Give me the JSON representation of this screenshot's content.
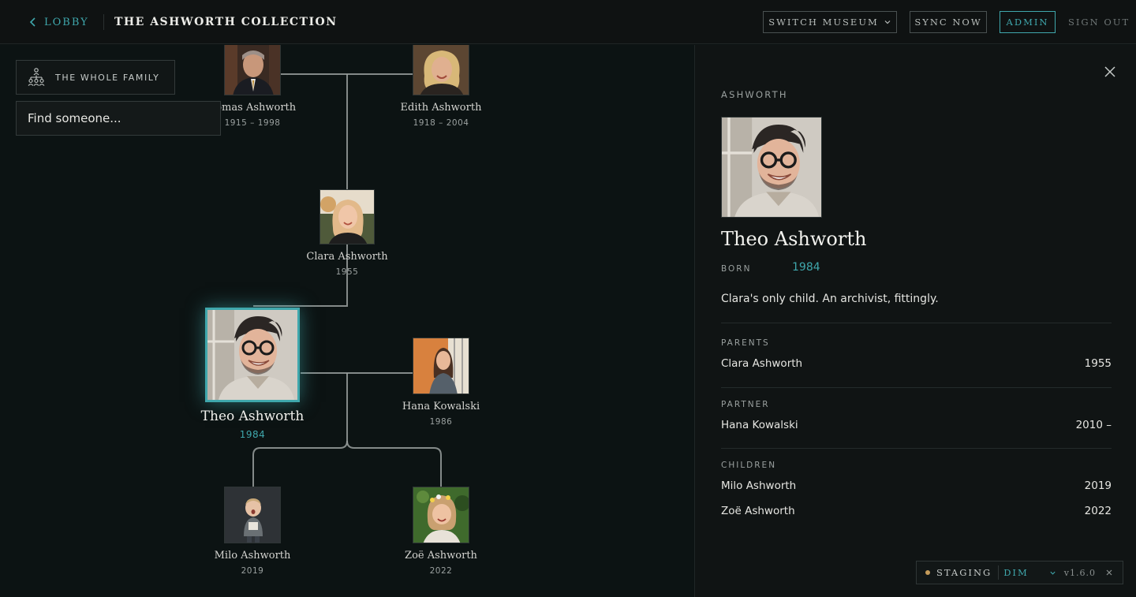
{
  "header": {
    "back_label": "LOBBY",
    "title": "THE ASHWORTH COLLECTION",
    "switch_label": "SWITCH MUSEUM",
    "sync_label": "SYNC NOW",
    "admin_label": "ADMIN",
    "signout_label": "SIGN OUT"
  },
  "tree": {
    "family_button": "THE WHOLE FAMILY",
    "search_placeholder": "Find someone...",
    "people": {
      "thomas": {
        "name": "homas Ashworth",
        "years": "1915 – 1998"
      },
      "edith": {
        "name": "Edith Ashworth",
        "years": "1918 – 2004"
      },
      "clara": {
        "name": "Clara Ashworth",
        "years": "1955"
      },
      "theo": {
        "name": "Theo Ashworth",
        "years": "1984"
      },
      "hana": {
        "name": "Hana Kowalski",
        "years": "1986"
      },
      "milo": {
        "name": "Milo Ashworth",
        "years": "2019"
      },
      "zoe": {
        "name": "Zoë Ashworth",
        "years": "2022"
      }
    }
  },
  "detail": {
    "family": "ASHWORTH",
    "name": "Theo Ashworth",
    "born_label": "BORN",
    "born_value": "1984",
    "bio": "Clara's only child. An archivist, fittingly.",
    "parents_label": "PARENTS",
    "parents": [
      {
        "name": "Clara Ashworth",
        "year": "1955"
      }
    ],
    "partner_label": "PARTNER",
    "partner": [
      {
        "name": "Hana Kowalski",
        "year": "2010 –"
      }
    ],
    "children_label": "CHILDREN",
    "children": [
      {
        "name": "Milo Ashworth",
        "year": "2019"
      },
      {
        "name": "Zoë Ashworth",
        "year": "2022"
      }
    ]
  },
  "env": {
    "label": "STAGING",
    "mode": "DIM",
    "version": "v1.6.0"
  },
  "colors": {
    "accent": "#3fa7ac",
    "background": "#0c1212",
    "staging_dot": "#c59b5a"
  }
}
